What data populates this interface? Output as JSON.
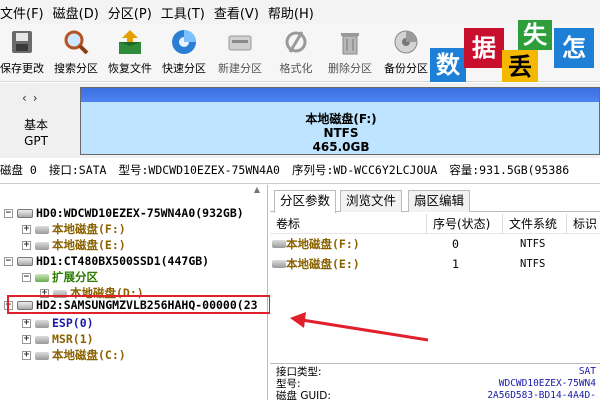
{
  "menu": [
    "文件(F)",
    "磁盘(D)",
    "分区(P)",
    "工具(T)",
    "查看(V)",
    "帮助(H)"
  ],
  "toolbar": [
    {
      "label": "保存更改",
      "icon": "disk-save-icon",
      "disabled": false
    },
    {
      "label": "搜索分区",
      "icon": "magnifier-icon",
      "disabled": false
    },
    {
      "label": "恢复文件",
      "icon": "recover-box-icon",
      "disabled": false
    },
    {
      "label": "快速分区",
      "icon": "quick-partition-icon",
      "disabled": false
    },
    {
      "label": "新建分区",
      "icon": "new-partition-icon",
      "disabled": true
    },
    {
      "label": "格式化",
      "icon": "format-icon",
      "disabled": true
    },
    {
      "label": "删除分区",
      "icon": "trash-icon",
      "disabled": true
    },
    {
      "label": "备份分区",
      "icon": "backup-icon",
      "disabled": false
    }
  ],
  "logo": {
    "tiles": [
      "数",
      "据",
      "丢",
      "失",
      "怎"
    ],
    "colors": [
      "#1d7fd6",
      "#c8102e",
      "#f5b800",
      "#2e9e3b",
      "#1d7fd6"
    ]
  },
  "diskmap": {
    "nav": "‹›",
    "type_line1": "基本",
    "type_line2": "GPT",
    "partition_name": "本地磁盘(F:)",
    "partition_fs": "NTFS",
    "partition_size": "465.0GB"
  },
  "disk_info": {
    "disk": "磁盘 0",
    "interface": "接口:SATA",
    "model": "型号:WDCWD10EZEX-75WN4A0",
    "serial": "序列号:WD-WCC6Y2LCJOUA",
    "capacity": "容量:931.5GB(95386"
  },
  "tree": [
    {
      "label": "HD0:WDCWD10EZEX-75WN4A0(932GB)",
      "kind": "disk",
      "exp": "−"
    },
    {
      "label": "本地磁盘(F:)",
      "kind": "part",
      "exp": "+"
    },
    {
      "label": "本地磁盘(E:)",
      "kind": "part",
      "exp": "+"
    },
    {
      "label": "HD1:CT480BX500SSD1(447GB)",
      "kind": "disk",
      "exp": "−"
    },
    {
      "label": "扩展分区",
      "kind": "extp",
      "exp": "−"
    },
    {
      "label": "本地磁盘(D:)",
      "kind": "part",
      "exp": "+"
    },
    {
      "label": "HD2:SAMSUNGMZVLB256HAHQ-00000(23",
      "kind": "disk",
      "exp": "−"
    },
    {
      "label": "ESP(0)",
      "kind": "blue",
      "exp": "+"
    },
    {
      "label": "MSR(1)",
      "kind": "part",
      "exp": "+"
    },
    {
      "label": "本地磁盘(C:)",
      "kind": "part",
      "exp": "+"
    }
  ],
  "tabs": [
    "分区参数",
    "浏览文件",
    "扇区编辑"
  ],
  "columns": [
    "卷标",
    "序号(状态)",
    "文件系统",
    "标识"
  ],
  "partitions": [
    {
      "name": "本地磁盘(F:)",
      "seq": "0",
      "fs": "NTFS"
    },
    {
      "name": "本地磁盘(E:)",
      "seq": "1",
      "fs": "NTFS"
    }
  ],
  "details": [
    {
      "label": "接口类型:",
      "value": "SAT"
    },
    {
      "label": "型号:",
      "value": "WDCWD10EZEX-75WN4"
    },
    {
      "label": "磁盘 GUID:",
      "value": "2A56D583-BD14-4A4D-"
    }
  ]
}
